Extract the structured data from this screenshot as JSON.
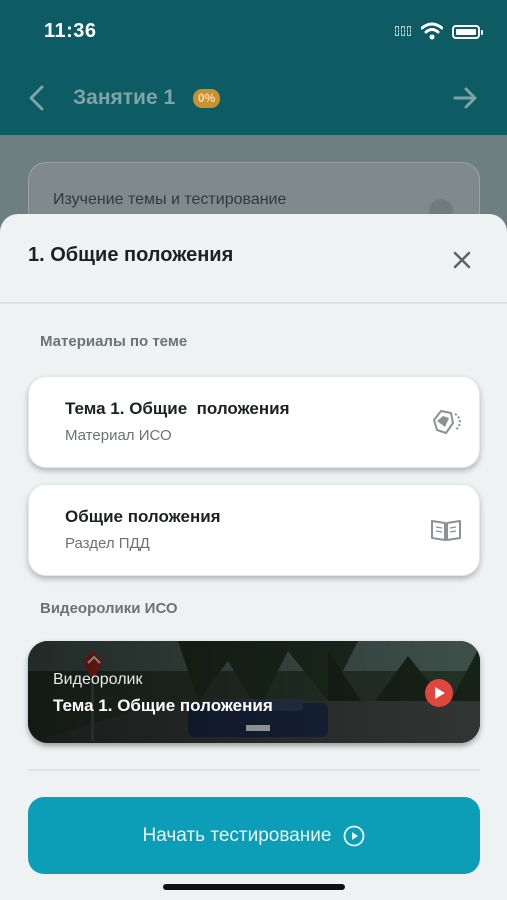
{
  "status_bar": {
    "time": "11:36"
  },
  "nav": {
    "title": "Занятие 1",
    "progress_badge": "0%"
  },
  "background_card": {
    "text": "Изучение темы и тестирование"
  },
  "sheet": {
    "title": "1. Общие положения",
    "materials_label": "Материалы по теме",
    "materials": [
      {
        "title": "Тема 1. Общие  положения",
        "subtitle": "Материал ИСО",
        "icon": "iso-material-icon"
      },
      {
        "title": "Общие положения",
        "subtitle": "Раздел ПДД",
        "icon": "book-icon"
      }
    ],
    "videos_label": "Видеоролики ИСО",
    "video": {
      "kicker": "Видеоролик",
      "title": "Тема 1. Общие положения"
    },
    "start_button_label": "Начать тестирование"
  },
  "colors": {
    "header": "#0d5c63",
    "accent": "#0c9db7",
    "badge": "#c99030",
    "play": "#e0463d"
  }
}
